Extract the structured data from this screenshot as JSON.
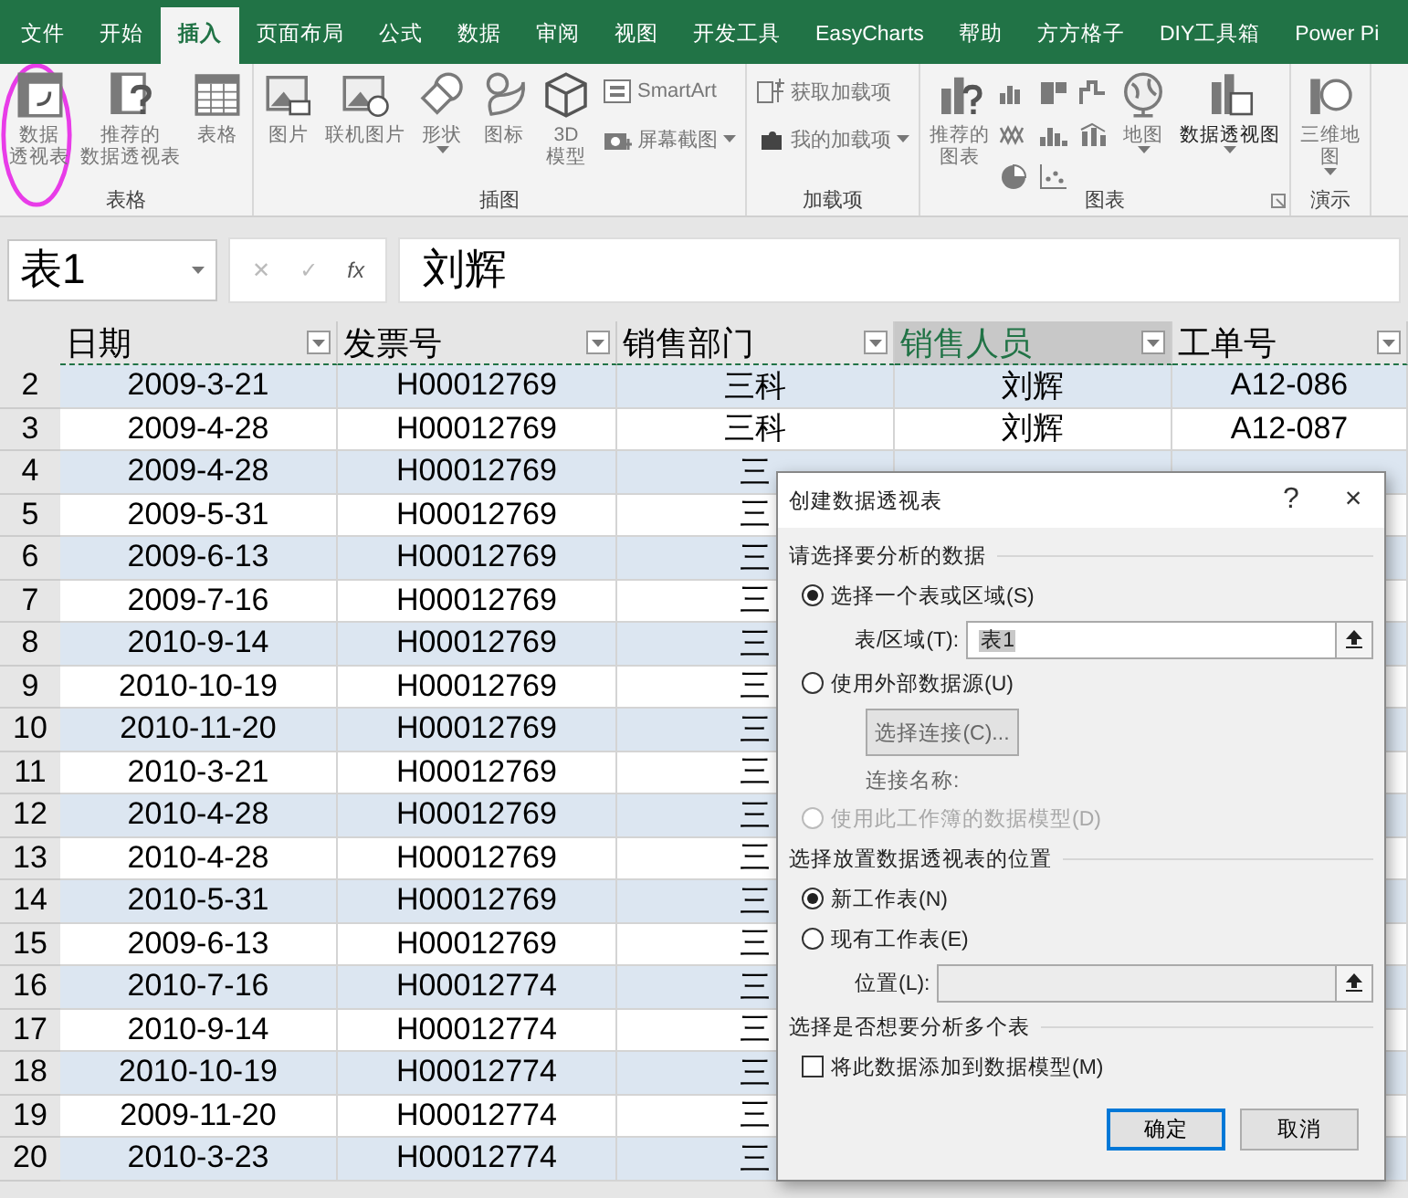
{
  "ribbon": {
    "tabs": [
      {
        "label": "文件",
        "selected": false
      },
      {
        "label": "开始",
        "selected": false
      },
      {
        "label": "插入",
        "selected": true
      },
      {
        "label": "页面布局",
        "selected": false
      },
      {
        "label": "公式",
        "selected": false
      },
      {
        "label": "数据",
        "selected": false
      },
      {
        "label": "审阅",
        "selected": false
      },
      {
        "label": "视图",
        "selected": false
      },
      {
        "label": "开发工具",
        "selected": false
      },
      {
        "label": "EasyCharts",
        "selected": false
      },
      {
        "label": "帮助",
        "selected": false
      },
      {
        "label": "方方格子",
        "selected": false
      },
      {
        "label": "DIY工具箱",
        "selected": false
      },
      {
        "label": "Power Pi",
        "selected": false
      }
    ],
    "groups": [
      {
        "label": "表格",
        "items": [
          {
            "kind": "large",
            "lines": [
              "数据",
              "透视表"
            ],
            "highlighted": true
          },
          {
            "kind": "large",
            "lines": [
              "推荐的",
              "数据透视表"
            ]
          },
          {
            "kind": "large",
            "lines": [
              "表格"
            ]
          }
        ]
      },
      {
        "label": "插图",
        "items": [
          {
            "kind": "large",
            "lines": [
              "图片"
            ]
          },
          {
            "kind": "large",
            "lines": [
              "联机图片"
            ]
          },
          {
            "kind": "large",
            "lines": [
              "形状"
            ],
            "dropdown": true
          },
          {
            "kind": "large",
            "lines": [
              "图标"
            ]
          },
          {
            "kind": "large",
            "lines": [
              "3D",
              "模型"
            ]
          },
          {
            "kind": "small",
            "label": "SmartArt"
          },
          {
            "kind": "small",
            "label": "屏幕截图",
            "dropdown": true
          }
        ]
      },
      {
        "label": "加载项",
        "items": [
          {
            "kind": "small",
            "label": "获取加载项"
          },
          {
            "kind": "small",
            "label": "我的加载项",
            "dropdown": true
          }
        ]
      },
      {
        "label": "图表",
        "launcher": true,
        "items": [
          {
            "kind": "large",
            "lines": [
              "推荐的",
              "图表"
            ]
          },
          {
            "kind": "minis"
          },
          {
            "kind": "large",
            "lines": [
              "地图"
            ],
            "dropdown": true
          },
          {
            "kind": "large",
            "lines": [
              "数据透视图"
            ],
            "dropdown": true,
            "strong": true
          }
        ]
      },
      {
        "label": "演示",
        "items": [
          {
            "kind": "large",
            "lines": [
              "三维地",
              "图"
            ],
            "dropdown": true
          }
        ]
      }
    ]
  },
  "name_box": {
    "value": "表1"
  },
  "formula_bar": {
    "buttons": [
      "✕",
      "✓",
      "fx"
    ],
    "value": "刘辉"
  },
  "sheet": {
    "columns": [
      {
        "label": "日期",
        "selected": false
      },
      {
        "label": "发票号",
        "selected": false
      },
      {
        "label": "销售部门",
        "selected": false
      },
      {
        "label": "销售人员",
        "selected": true
      },
      {
        "label": "工单号",
        "selected": false
      }
    ],
    "rows": [
      {
        "number": "2",
        "cells": [
          "2009-3-21",
          "H00012769",
          "三科",
          "刘辉",
          "A12-086"
        ]
      },
      {
        "number": "3",
        "cells": [
          "2009-4-28",
          "H00012769",
          "三科",
          "刘辉",
          "A12-087"
        ]
      },
      {
        "number": "4",
        "cells": [
          "2009-4-28",
          "H00012769",
          "三"
        ]
      },
      {
        "number": "5",
        "cells": [
          "2009-5-31",
          "H00012769",
          "三"
        ]
      },
      {
        "number": "6",
        "cells": [
          "2009-6-13",
          "H00012769",
          "三"
        ]
      },
      {
        "number": "7",
        "cells": [
          "2009-7-16",
          "H00012769",
          "三"
        ]
      },
      {
        "number": "8",
        "cells": [
          "2010-9-14",
          "H00012769",
          "三"
        ]
      },
      {
        "number": "9",
        "cells": [
          "2010-10-19",
          "H00012769",
          "三"
        ]
      },
      {
        "number": "10",
        "cells": [
          "2010-11-20",
          "H00012769",
          "三"
        ]
      },
      {
        "number": "11",
        "cells": [
          "2010-3-21",
          "H00012769",
          "三"
        ]
      },
      {
        "number": "12",
        "cells": [
          "2010-4-28",
          "H00012769",
          "三"
        ]
      },
      {
        "number": "13",
        "cells": [
          "2010-4-28",
          "H00012769",
          "三"
        ]
      },
      {
        "number": "14",
        "cells": [
          "2010-5-31",
          "H00012769",
          "三"
        ]
      },
      {
        "number": "15",
        "cells": [
          "2009-6-13",
          "H00012769",
          "三"
        ]
      },
      {
        "number": "16",
        "cells": [
          "2010-7-16",
          "H00012774",
          "三"
        ]
      },
      {
        "number": "17",
        "cells": [
          "2010-9-14",
          "H00012774",
          "三"
        ]
      },
      {
        "number": "18",
        "cells": [
          "2010-10-19",
          "H00012774",
          "三"
        ]
      },
      {
        "number": "19",
        "cells": [
          "2009-11-20",
          "H00012774",
          "三"
        ]
      },
      {
        "number": "20",
        "cells": [
          "2010-3-23",
          "H00012774",
          "三"
        ]
      }
    ]
  },
  "dialog": {
    "title": "创建数据透视表",
    "help": "?",
    "close": "×",
    "items": [
      {
        "kind": "heading",
        "label": "请选择要分析的数据"
      },
      {
        "kind": "radio",
        "label": "选择一个表或区域(S)",
        "selected": true,
        "disabled": false
      },
      {
        "kind": "field",
        "label": "表/区域(T):",
        "value": "表1",
        "disabled": false
      },
      {
        "kind": "radio",
        "label": "使用外部数据源(U)",
        "selected": false,
        "disabled": false
      },
      {
        "kind": "button",
        "label": "选择连接(C)..."
      },
      {
        "kind": "note",
        "label": "连接名称:"
      },
      {
        "kind": "radio",
        "label": "使用此工作簿的数据模型(D)",
        "selected": false,
        "disabled": true
      },
      {
        "kind": "heading",
        "label": "选择放置数据透视表的位置"
      },
      {
        "kind": "radio",
        "label": "新工作表(N)",
        "selected": true,
        "disabled": false
      },
      {
        "kind": "radio",
        "label": "现有工作表(E)",
        "selected": false,
        "disabled": false
      },
      {
        "kind": "field",
        "label": "位置(L):",
        "disabled": true
      },
      {
        "kind": "heading",
        "label": "选择是否想要分析多个表"
      },
      {
        "kind": "checkbox",
        "label": "将此数据添加到数据模型(M)",
        "checked": false
      }
    ],
    "buttons": [
      {
        "label": "确定",
        "default": true
      },
      {
        "label": "取消",
        "default": false
      }
    ]
  }
}
